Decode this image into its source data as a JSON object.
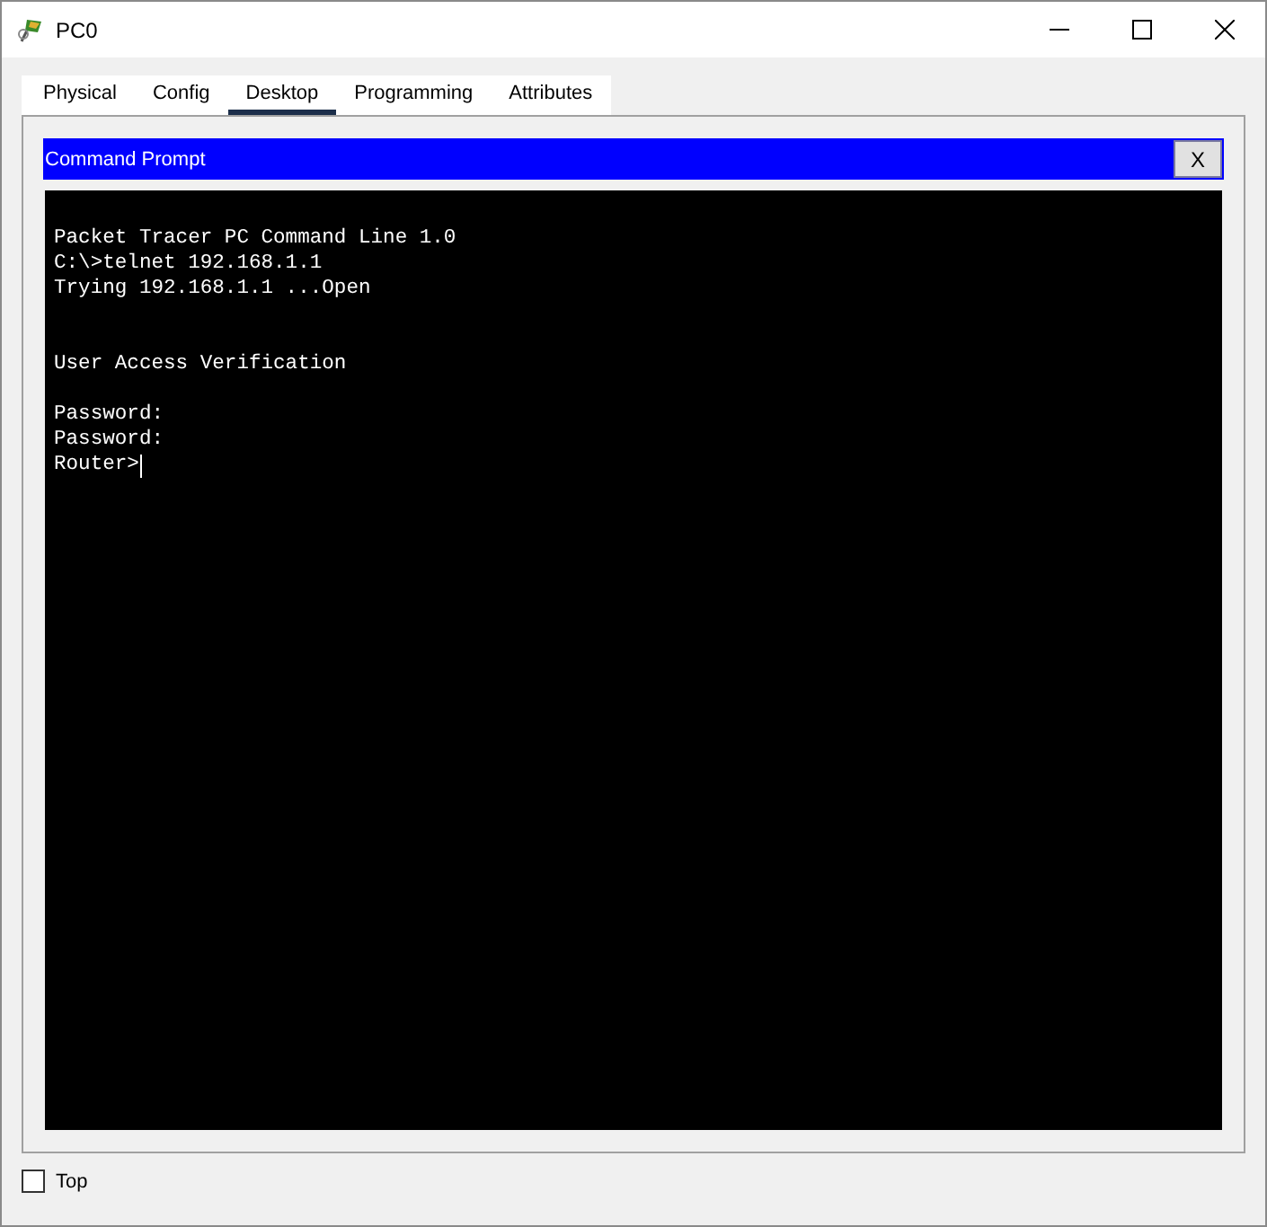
{
  "window": {
    "title": "PC0"
  },
  "tabs": [
    {
      "label": "Physical",
      "selected": false
    },
    {
      "label": "Config",
      "selected": false
    },
    {
      "label": "Desktop",
      "selected": true
    },
    {
      "label": "Programming",
      "selected": false
    },
    {
      "label": "Attributes",
      "selected": false
    }
  ],
  "app": {
    "title": "Command Prompt",
    "close_label": "X"
  },
  "terminal": {
    "output": "Packet Tracer PC Command Line 1.0\nC:\\>telnet 192.168.1.1\nTrying 192.168.1.1 ...Open\n\n\nUser Access Verification\n\nPassword: \nPassword: ",
    "prompt": "Router>"
  },
  "top_option": {
    "label": "Top",
    "checked": false
  }
}
